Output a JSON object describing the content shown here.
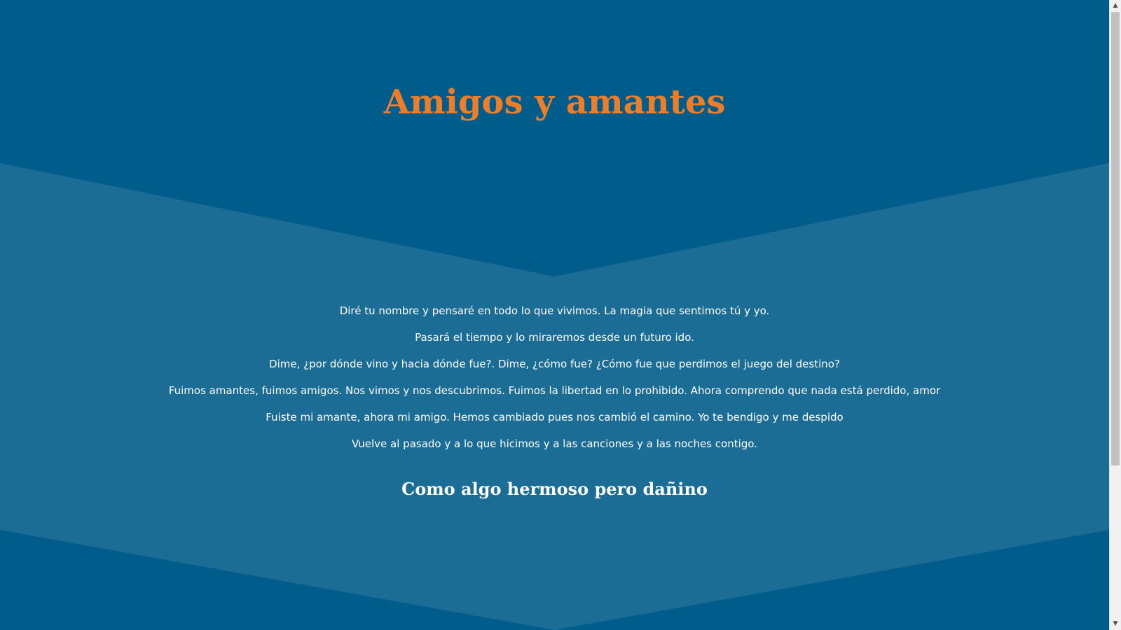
{
  "page": {
    "title": "Amigos y amantes",
    "lyrics": [
      "Diré tu nombre y pensaré en todo lo que vivimos. La magia que sentimos tú y yo.",
      "Pasará el tiempo y lo miraremos desde un futuro ido.",
      "Dime, ¿por dónde vino y hacia dónde fue?. Dime, ¿cómo fue? ¿Cómo fue que perdimos el juego del destino?",
      "Fuimos amantes, fuimos amigos. Nos vimos y nos descubrimos. Fuimos la libertad en lo prohibido. Ahora comprendo que nada está perdido, amor",
      "Fuiste mi amante, ahora mi amigo. Hemos cambiado pues nos cambió el camino. Yo te bendigo y me despido",
      "Vuelve al pasado y a lo que hicimos y a las canciones y a las noches contigo."
    ],
    "subtitle": "Como algo hermoso pero dañino"
  },
  "scrollbar": {
    "up_icon": "chevron-up-icon",
    "down_icon": "chevron-down-icon",
    "up_glyph": "▲",
    "down_glyph": "▼"
  },
  "colors": {
    "dark_blue": "#005c8b",
    "light_blue": "#1c6d95",
    "title_orange": "#ee7d28",
    "text_white": "#ffffff"
  }
}
